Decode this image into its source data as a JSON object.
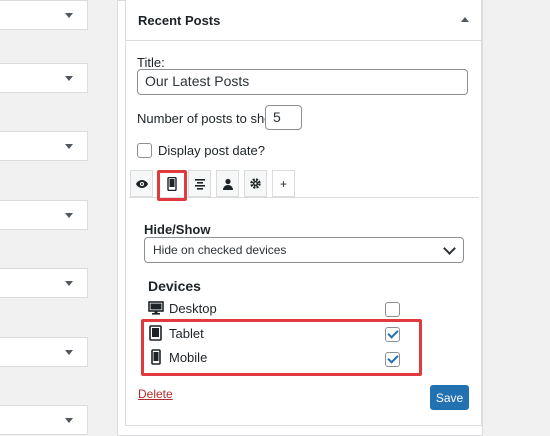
{
  "widget": {
    "title": "Recent Posts"
  },
  "form": {
    "title_label": "Title:",
    "title_value": "Our Latest Posts",
    "count_label": "Number of posts to show:",
    "count_value": "5",
    "show_date_label": "Display post date?",
    "show_date_checked": false
  },
  "tabs": [
    {
      "icon": "eye-icon",
      "active": false
    },
    {
      "icon": "mobile-device-icon",
      "active": true
    },
    {
      "icon": "align-center-icon",
      "active": false
    },
    {
      "icon": "user-icon",
      "active": false
    },
    {
      "icon": "gear-icon",
      "active": false
    },
    {
      "icon": "plus-icon",
      "label": "+",
      "active": false
    }
  ],
  "visibility": {
    "heading": "Hide/Show",
    "select_value": "Hide on checked devices",
    "devices_heading": "Devices",
    "devices": [
      {
        "label": "Desktop",
        "icon": "desktop-icon",
        "checked": false
      },
      {
        "label": "Tablet",
        "icon": "tablet-icon",
        "checked": true
      },
      {
        "label": "Mobile",
        "icon": "mobile-icon",
        "checked": true
      }
    ]
  },
  "actions": {
    "delete_label": "Delete",
    "save_label": "Save"
  },
  "colors": {
    "highlight": "#e03a3e",
    "primary_button": "#2271b1",
    "delete_link": "#b32d2e"
  }
}
